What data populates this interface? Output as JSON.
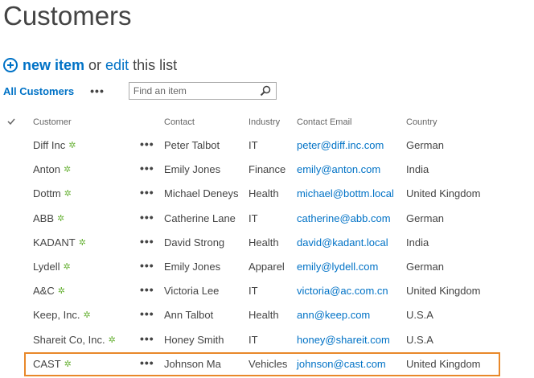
{
  "page": {
    "title": "Customers"
  },
  "toolbar": {
    "new_item_label": "new item",
    "or_label": "or",
    "edit_label": "edit",
    "this_list_label": "this list"
  },
  "view": {
    "current_view": "All Customers",
    "more_label": "•••",
    "search_placeholder": "Find an item"
  },
  "table": {
    "columns": {
      "customer": "Customer",
      "contact": "Contact",
      "industry": "Industry",
      "email": "Contact Email",
      "country": "Country"
    },
    "row_menu_label": "•••",
    "new_badge": "✲",
    "rows": [
      {
        "customer": "Diff Inc",
        "contact": "Peter Talbot",
        "industry": "IT",
        "email": "peter@diff.inc.com",
        "country": "German"
      },
      {
        "customer": "Anton",
        "contact": "Emily Jones",
        "industry": "Finance",
        "email": "emily@anton.com",
        "country": "India"
      },
      {
        "customer": "Dottm",
        "contact": "Michael Deneys",
        "industry": "Health",
        "email": "michael@bottm.local",
        "country": "United Kingdom"
      },
      {
        "customer": "ABB",
        "contact": "Catherine Lane",
        "industry": "IT",
        "email": "catherine@abb.com",
        "country": "German"
      },
      {
        "customer": "KADANT",
        "contact": "David Strong",
        "industry": "Health",
        "email": "david@kadant.local",
        "country": "India"
      },
      {
        "customer": "Lydell",
        "contact": "Emily Jones",
        "industry": "Apparel",
        "email": "emily@lydell.com",
        "country": "German"
      },
      {
        "customer": "A&C",
        "contact": "Victoria Lee",
        "industry": "IT",
        "email": "victoria@ac.com.cn",
        "country": "United Kingdom"
      },
      {
        "customer": "Keep, Inc.",
        "contact": "Ann Talbot",
        "industry": "Health",
        "email": "ann@keep.com",
        "country": "U.S.A"
      },
      {
        "customer": "Shareit Co, Inc.",
        "contact": "Honey Smith",
        "industry": "IT",
        "email": "honey@shareit.com",
        "country": "U.S.A"
      },
      {
        "customer": "CAST",
        "contact": "Johnson Ma",
        "industry": "Vehicles",
        "email": "johnson@cast.com",
        "country": "United Kingdom"
      }
    ]
  },
  "colors": {
    "accent": "#0072c6",
    "text": "#444444",
    "new_badge": "#6bb33a",
    "selection_border": "#e8882a"
  }
}
